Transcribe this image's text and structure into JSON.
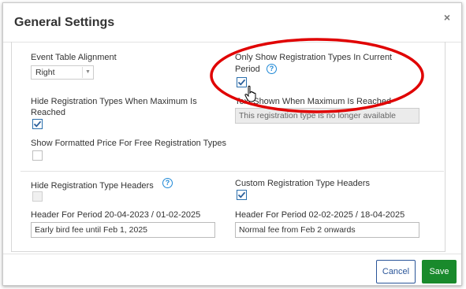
{
  "dialog": {
    "title": "General Settings",
    "close_glyph": "×"
  },
  "fields": {
    "event_table_alignment": {
      "label": "Event Table Alignment",
      "value": "Right"
    },
    "only_show_current": {
      "label_line1": "Only Show Registration Types In Current",
      "label_line2": "Period",
      "checked": true
    },
    "hide_when_max": {
      "label_line1": "Hide Registration Types When Maximum Is",
      "label_line2": "Reached",
      "checked": true
    },
    "text_shown_when_max": {
      "label": "Text Shown When Maximum Is Reached",
      "value": "This registration type is no longer available"
    },
    "show_formatted_price": {
      "label": "Show Formatted Price For Free Registration Types",
      "checked": false
    },
    "hide_headers": {
      "label": "Hide Registration Type Headers",
      "checked": false
    },
    "custom_headers": {
      "label": "Custom Registration Type Headers",
      "checked": true
    },
    "header_period_1": {
      "label": "Header For Period 20-04-2023 / 01-02-2025",
      "value": "Early bird fee until Feb 1, 2025"
    },
    "header_period_2": {
      "label": "Header For Period 02-02-2025 / 18-04-2025",
      "value": "Normal fee from Feb 2 onwards"
    }
  },
  "footer": {
    "cancel_label": "Cancel",
    "save_label": "Save"
  },
  "colors": {
    "save": "#198a2c",
    "cancel": "#2a5599",
    "help": "#1e88d6",
    "highlight": "#e00000"
  },
  "icons": [
    "close-icon",
    "help-icon",
    "check-icon",
    "dropdown-arrow-icon",
    "hand-cursor-icon"
  ]
}
